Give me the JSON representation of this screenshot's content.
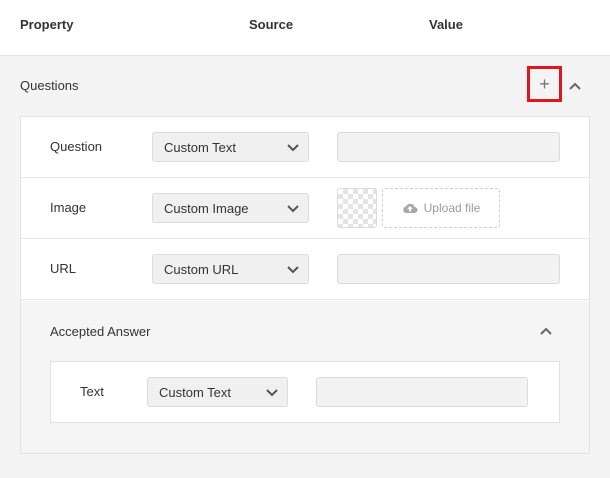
{
  "header": {
    "property": "Property",
    "source": "Source",
    "value": "Value"
  },
  "section": {
    "title": "Questions",
    "add_symbol": "+"
  },
  "rows": [
    {
      "label": "Question",
      "source": "Custom Text"
    },
    {
      "label": "Image",
      "source": "Custom Image",
      "upload_label": "Upload file"
    },
    {
      "label": "URL",
      "source": "Custom URL"
    }
  ],
  "accepted_answer": {
    "title": "Accepted Answer",
    "row": {
      "label": "Text",
      "source": "Custom Text"
    }
  },
  "icons": {
    "add": "plus-icon",
    "collapse": "chevron-up-icon",
    "dropdown": "chevron-down-icon",
    "upload": "cloud-upload-icon"
  },
  "colors": {
    "highlight": "#e0151d",
    "background": "#f4f4f4",
    "panel": "#ffffff"
  }
}
